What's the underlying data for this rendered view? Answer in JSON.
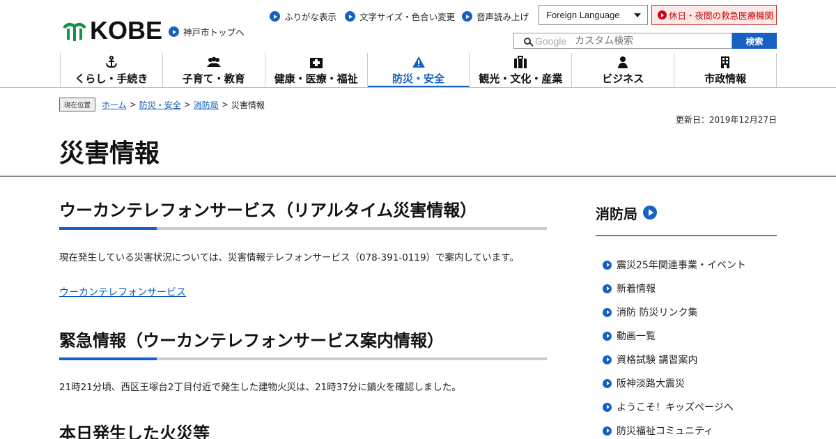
{
  "header": {
    "logo_text": "KOBE",
    "home_link": "神戸市トップへ",
    "util_links": [
      "ふりがな表示",
      "文字サイズ・色合い変更",
      "音声読み上げ"
    ],
    "language_select": "Foreign Language",
    "emergency_link": "休日・夜間の救急医療機関",
    "search": {
      "brand": "Google",
      "placeholder": "カスタム検索",
      "button": "検索"
    }
  },
  "nav": {
    "items": [
      {
        "label": "くらし・手続き",
        "icon": "anchor-icon"
      },
      {
        "label": "子育て・教育",
        "icon": "people-icon"
      },
      {
        "label": "健康・医療・福祉",
        "icon": "hospital-icon"
      },
      {
        "label": "防災・安全",
        "icon": "warning-icon"
      },
      {
        "label": "観光・文化・産業",
        "icon": "suitcase-icon"
      },
      {
        "label": "ビジネス",
        "icon": "person-icon"
      },
      {
        "label": "市政情報",
        "icon": "building-icon"
      }
    ],
    "active_index": 3
  },
  "breadcrumb": {
    "here_label": "現在位置",
    "links": [
      "ホーム",
      "防災・安全",
      "消防局"
    ],
    "current": "災害情報"
  },
  "updated": "更新日：2019年12月27日",
  "page_title": "災害情報",
  "main": {
    "section1": {
      "heading": "ウーカンテレフォンサービス（リアルタイム災害情報）",
      "text": "現在発生している災害状況については、災害情報テレフォンサービス（078-391-0119）で案内しています。",
      "link": "ウーカンテレフォンサービス"
    },
    "section2": {
      "heading": "緊急情報（ウーカンテレフォンサービス案内情報）",
      "text": "21時21分頃、西区王塚台2丁目付近で発生した建物火災は、21時37分に鎮火を確認しました。"
    },
    "section3": {
      "heading": "本日発生した火災等"
    }
  },
  "sidebar": {
    "heading": "消防局",
    "items": [
      "震災25年関連事業・イベント",
      "新着情報",
      "消防 防災リンク集",
      "動画一覧",
      "資格試験 講習案内",
      "阪神淡路大震災",
      "ようこそ！キッズページへ",
      "防災福祉コミュニティ"
    ]
  },
  "colors": {
    "accent": "#1761c4",
    "logo_green": "#14924a",
    "emergency": "#d0021b"
  }
}
